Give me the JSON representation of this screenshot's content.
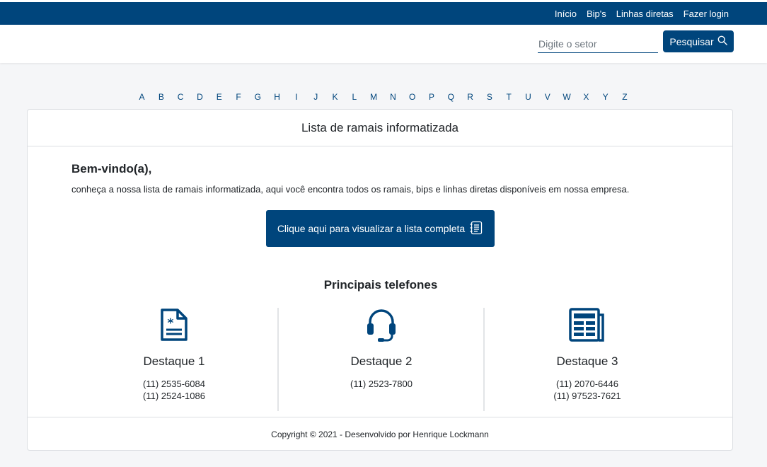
{
  "nav": {
    "items": [
      "Início",
      "Bip's",
      "Linhas diretas",
      "Fazer login"
    ]
  },
  "search": {
    "placeholder": "Digite o setor",
    "button_label": "Pesquisar",
    "icon": "search-icon"
  },
  "alphabet": [
    "A",
    "B",
    "C",
    "D",
    "E",
    "F",
    "G",
    "H",
    "I",
    "J",
    "K",
    "L",
    "M",
    "N",
    "O",
    "P",
    "Q",
    "R",
    "S",
    "T",
    "U",
    "V",
    "W",
    "X",
    "Y",
    "Z"
  ],
  "card": {
    "title": "Lista de ramais informatizada",
    "welcome_title": "Bem-vindo(a),",
    "welcome_text": "conheça a nossa lista de ramais informatizada, aqui você encontra todos os ramais, bips e linhas diretas disponíveis em nossa empresa.",
    "list_button": "Clique aqui para visualizar a lista completa",
    "list_button_icon": "list-icon",
    "phones_title": "Principais telefones",
    "highlights": [
      {
        "title": "Destaque 1",
        "icon": "medical-document-icon",
        "phones": [
          "(11) 2535-6084",
          "(11) 2524-1086"
        ]
      },
      {
        "title": "Destaque 2",
        "icon": "headset-icon",
        "phones": [
          "(11) 2523-7800"
        ]
      },
      {
        "title": "Destaque 3",
        "icon": "newspaper-icon",
        "phones": [
          "(11) 2070-6446",
          "(11) 97523-7621"
        ]
      }
    ],
    "footer": "Copyright © 2021 - Desenvolvido por Henrique Lockmann"
  },
  "colors": {
    "primary": "#00457c",
    "background": "#f5f6f8"
  }
}
